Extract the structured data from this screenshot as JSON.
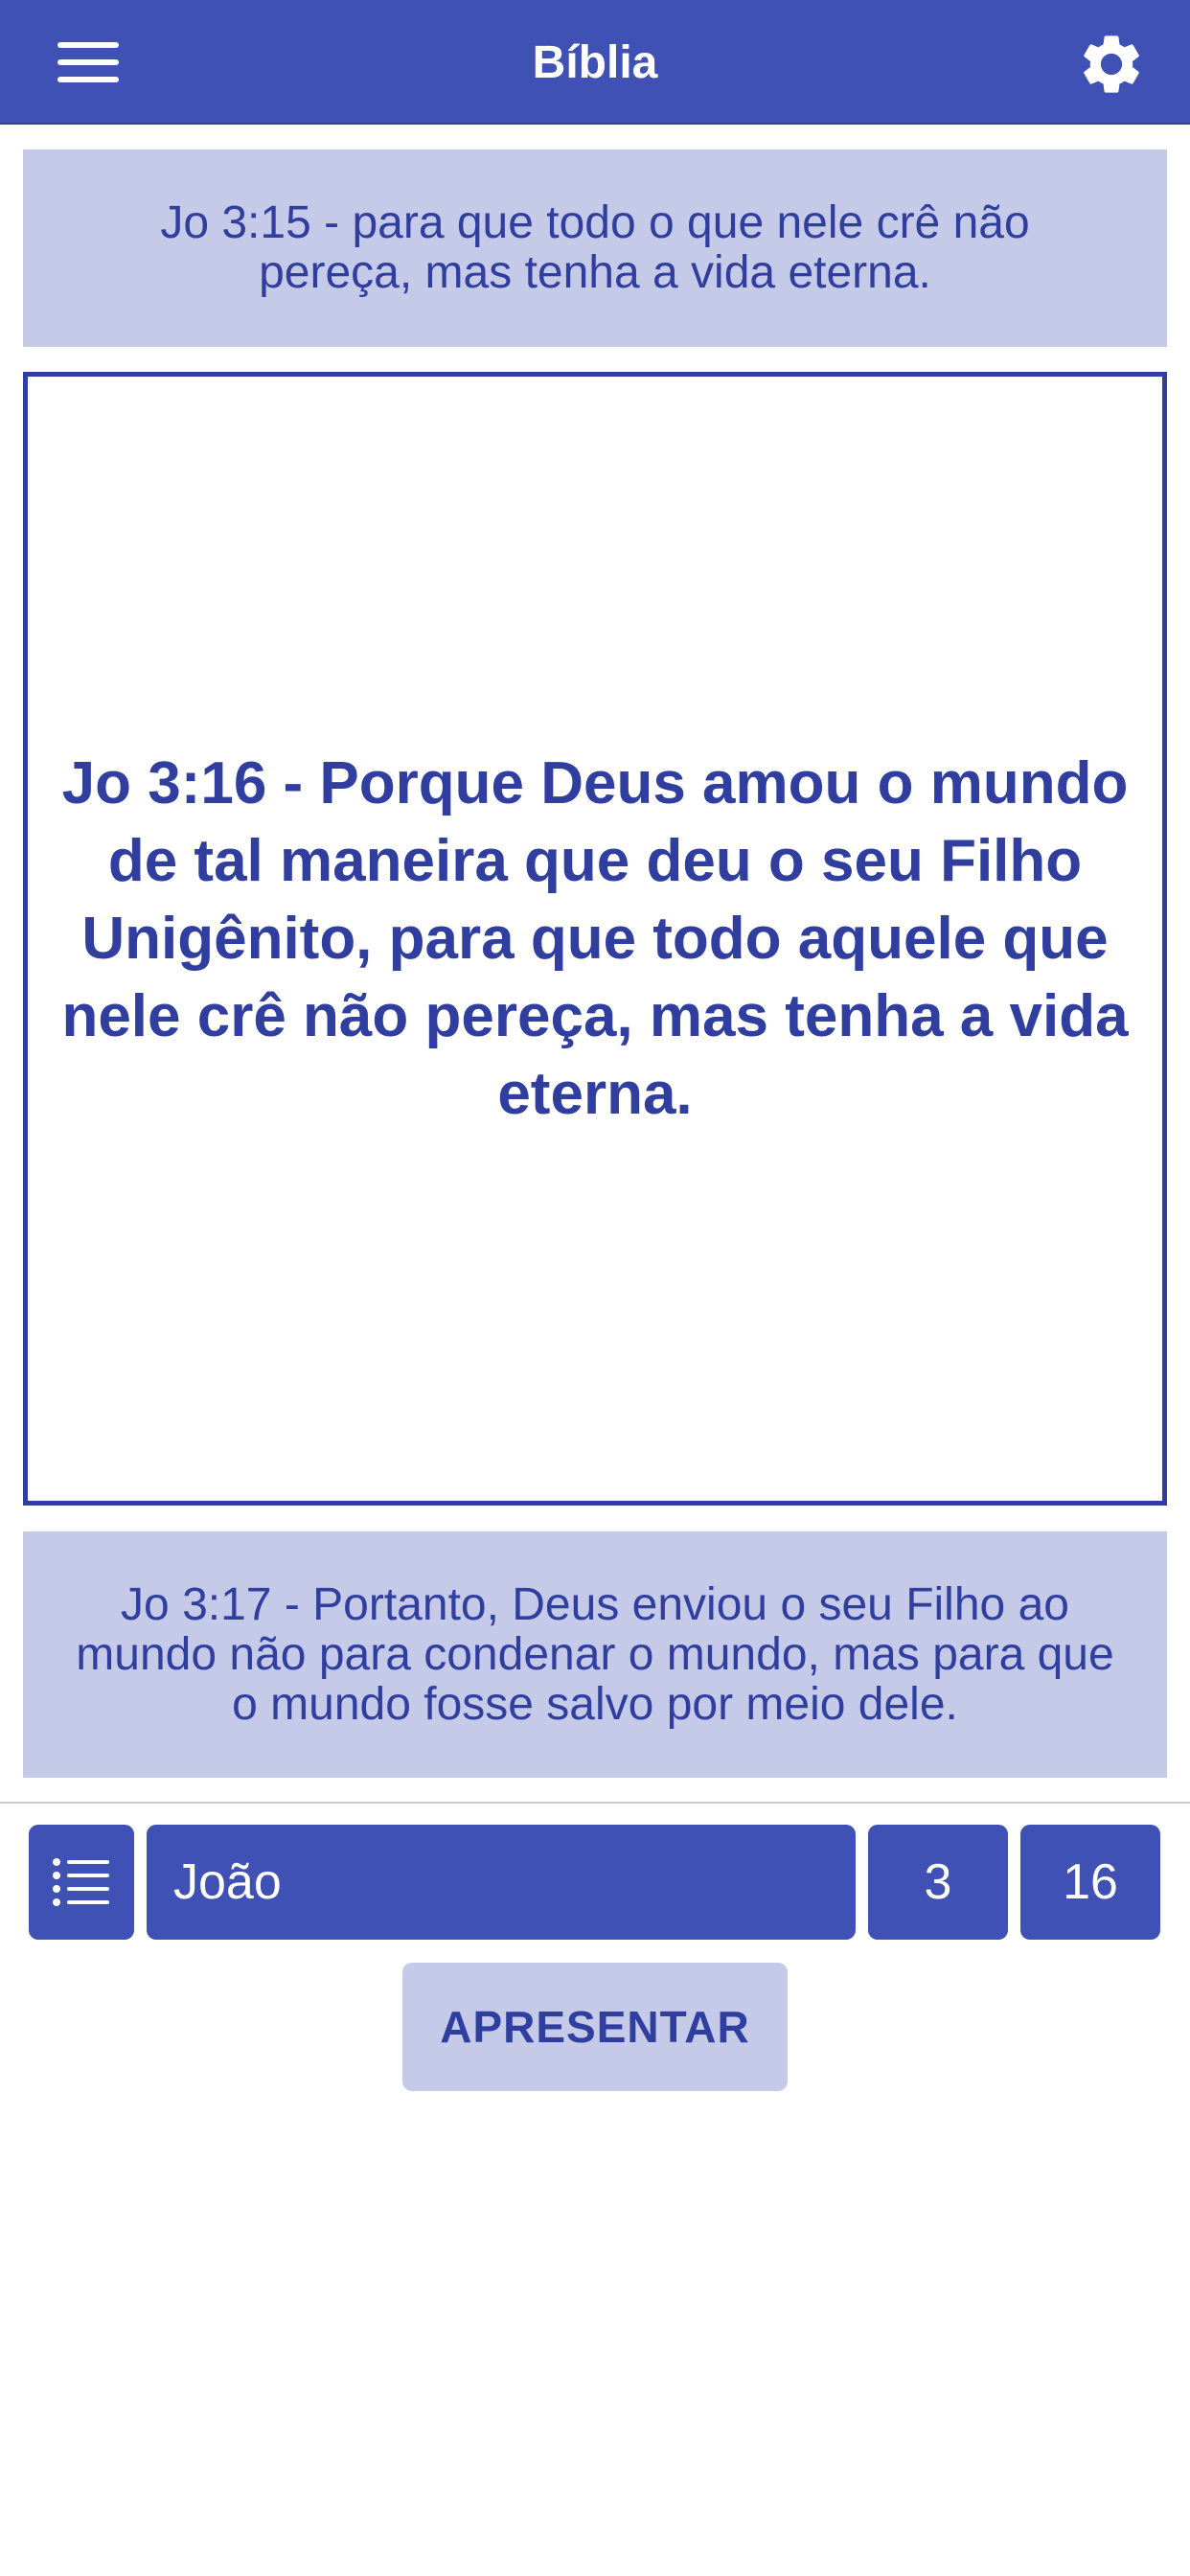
{
  "app_bar": {
    "title": "Bíblia",
    "background": "#3f51b5",
    "menu_icon": "menu-icon",
    "settings_icon": "gear-icon"
  },
  "verses": {
    "previous": "Jo 3:15 - para que todo o que nele crê não pereça, mas tenha a vida eterna.",
    "current": "Jo 3:16 - Porque Deus amou o mundo de tal maneira que deu o seu Filho Unigênito, para que todo aquele que nele crê não pereça, mas tenha a vida eterna.",
    "next": "Jo 3:17 - Portanto, Deus enviou o seu Filho ao mundo não para condenar o mundo, mas para que o mundo fosse salvo por meio dele."
  },
  "selector": {
    "list_icon": "list-icon",
    "book": "João",
    "chapter": "3",
    "verse": "16"
  },
  "actions": {
    "present_label": "APRESENTAR"
  },
  "colors": {
    "primary": "#3f51b5",
    "primary_dark": "#303f9f",
    "light": "#c5cae9"
  }
}
